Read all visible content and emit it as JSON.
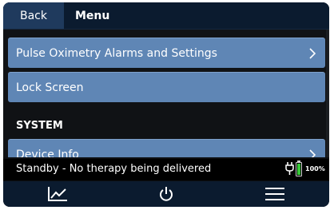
{
  "header": {
    "back_label": "Back",
    "title": "Menu"
  },
  "menu": {
    "items": [
      {
        "label": "Pulse Oximetry Alarms and Settings",
        "has_chevron": true
      },
      {
        "label": "Lock Screen",
        "has_chevron": false
      }
    ],
    "section_header": "SYSTEM",
    "system_items": [
      {
        "label": "Device Info",
        "has_chevron": true
      }
    ]
  },
  "status": {
    "message": "Standby - No therapy being delivered",
    "battery_percent": "100%",
    "battery_level": 1.0,
    "power_icon": "plug-icon"
  },
  "nav": {
    "buttons": [
      {
        "icon": "trend-chart-icon"
      },
      {
        "icon": "power-icon"
      },
      {
        "icon": "hamburger-menu-icon"
      }
    ]
  },
  "colors": {
    "header_bg": "#0b1b2f",
    "back_button_bg": "#1f3a5d",
    "menu_item_bg": "#5f86b5",
    "content_bg": "#101215",
    "battery_fill": "#36c836"
  }
}
